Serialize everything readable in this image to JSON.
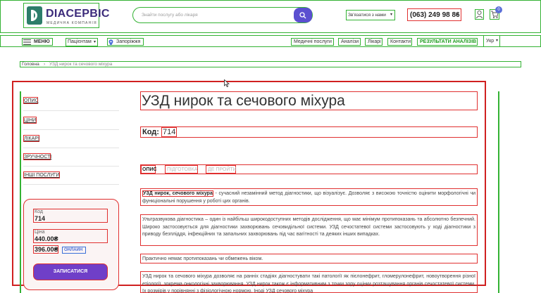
{
  "brand": {
    "name": "DIACEPBIC",
    "subtitle": "МЕДИЧНА КОМПАНІЯ"
  },
  "search": {
    "placeholder": "Знайти послугу або лікаря"
  },
  "header": {
    "contact_label": "Зв'язатися з нами",
    "phone": "(063) 249 98 86",
    "cart_count": "0"
  },
  "nav": {
    "menu": "МЕНЮ",
    "patients": "Пацієнтам",
    "city": "Запоріжжя",
    "links": [
      "Медичні послуги",
      "Аналізи",
      "Лікарі",
      "Контакти"
    ],
    "results": "РЕЗУЛЬТАТИ АНАЛІЗІВ",
    "lang": "Укр"
  },
  "breadcrumb": {
    "home": "Головна",
    "current": "УЗД нирок та сечового міхура"
  },
  "page": {
    "title": "УЗД нирок та сечового міхура",
    "code_label": "Код:",
    "code_value": "714"
  },
  "sidebar": {
    "links": [
      "ОПИС",
      "ЦІНИ",
      "ЛІКАРІ",
      "ЗРУЧНОСТІ",
      "ІНШІ ПОСЛУГИ"
    ]
  },
  "tabs": [
    "ОПИС",
    "ПІДГОТОВКА",
    "ДЕ ПРОЙТИ"
  ],
  "description": {
    "lead_bold": "УЗД нирок, сечового міхура",
    "lead_rest": " - сучасний незамінний метод діагностики, що візуалізує. Дозволяє з високою точністю оцінити морфологічні чи функціональні порушення у роботі цих органів.",
    "p2": "Ультразвукова діагностика – один із найбільш широкодоступних методів дослідження, що має мінімум протипоказань та абсолютно безпечний. Широко застосовується для діагностики захворювань сечовидільної системи. УЗД сечостатевої системи застосовують у ході діагностики з приводу безпліддя, інфекційних та запальних захворювань під час вагітності та деяких інших випадках.",
    "p3": "Практично немає протипоказань чи обмежень віком.",
    "p4": "УЗД нирок та сечового міхура дозволяє на ранніх стадіях діагностувати такі патології як пієлонефрит, гломерулонефрит, новоутворення різної етіології, зокрема онкологічні захворювання. УЗД нирок також є інформативним з точки зору оцінки розташування органів сечостатевої системи, їх розмірів у порівнянні з фізіологічною нормою. Іноді УЗД сечового міхура"
  },
  "price_card": {
    "code_label": "Код",
    "code_value": "714",
    "price_label": "Ціна",
    "price": "440.00₴",
    "online_price": "396.00₴",
    "online_label": "ОНЛАЙН",
    "button": "ЗАПИСАТИСЯ"
  },
  "colors": {
    "accent": "#5b4fd0",
    "button": "#6f3fc8",
    "results": "#1e9e1e",
    "brand": "#3b2a7a"
  }
}
